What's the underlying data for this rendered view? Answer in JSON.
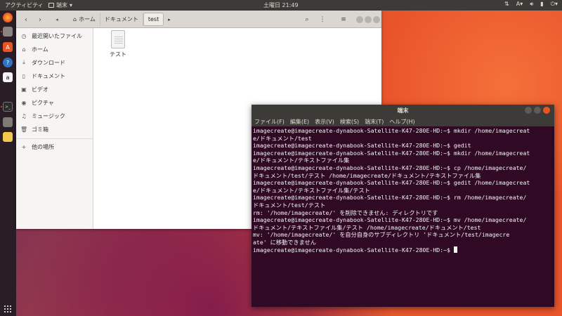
{
  "topbar": {
    "activities": "アクティビティ",
    "app_menu": "端末",
    "clock": "土曜日 21:49",
    "status_icons": [
      "network-icon",
      "input-method-icon",
      "sound-icon",
      "battery-icon",
      "power-icon"
    ],
    "input_method_label": "A"
  },
  "dock": {
    "items": [
      "firefox-icon",
      "files-icon",
      "software-icon",
      "help-icon",
      "amazon-icon",
      "terminal-icon",
      "screenshot-icon",
      "text-editor-icon"
    ],
    "amazon_label": "a"
  },
  "files": {
    "breadcrumbs": [
      "ホーム",
      "ドキュメント",
      "test"
    ],
    "sidebar": [
      {
        "icon": "clock-icon",
        "label": "最近開いたファイル"
      },
      {
        "icon": "home-icon",
        "label": "ホーム"
      },
      {
        "icon": "download-icon",
        "label": "ダウンロード"
      },
      {
        "icon": "document-icon",
        "label": "ドキュメント"
      },
      {
        "icon": "video-icon",
        "label": "ビデオ"
      },
      {
        "icon": "camera-icon",
        "label": "ピクチャ"
      },
      {
        "icon": "music-icon",
        "label": "ミュージック"
      },
      {
        "icon": "trash-icon",
        "label": "ゴミ箱"
      },
      {
        "icon": "plus-icon",
        "label": "他の場所"
      }
    ],
    "file": {
      "name": "テスト"
    }
  },
  "terminal": {
    "title": "端末",
    "menu": [
      "ファイル(F)",
      "編集(E)",
      "表示(V)",
      "検索(S)",
      "端末(T)",
      "ヘルプ(H)"
    ],
    "lines": [
      "imagecreate@imagecreate-dynabook-Satellite-K47-280E-HD:~$ mkdir /home/imagecreat",
      "e/ドキュメント/test",
      "imagecreate@imagecreate-dynabook-Satellite-K47-280E-HD:~$ gedit",
      "imagecreate@imagecreate-dynabook-Satellite-K47-280E-HD:~$ mkdir /home/imagecreat",
      "e/ドキュメント/テキストファイル集",
      "imagecreate@imagecreate-dynabook-Satellite-K47-280E-HD:~$ cp /home/imagecreate/",
      "ドキュメント/test/テスト /home/imagecreate/ドキュメント/テキストファイル集",
      "imagecreate@imagecreate-dynabook-Satellite-K47-280E-HD:~$ gedit /home/imagecreat",
      "e/ドキュメント/テキストファイル集/テスト",
      "imagecreate@imagecreate-dynabook-Satellite-K47-280E-HD:~$ rm /home/imagecreate/",
      "ドキュメント/test/テスト",
      "rm: '/home/imagecreate/' を削除できません: ディレクトリです",
      "imagecreate@imagecreate-dynabook-Satellite-K47-280E-HD:~$ mv /home/imagecreate/",
      "ドキュメント/テキストファイル集/テスト /home/imagecreate/ドキュメント/test",
      "mv: '/home/imagecreate/' を自分自身のサブディレクトリ 'ドキュメント/test/imagecre",
      "ate' に移動できません",
      "imagecreate@imagecreate-dynabook-Satellite-K47-280E-HD:~$ "
    ]
  }
}
